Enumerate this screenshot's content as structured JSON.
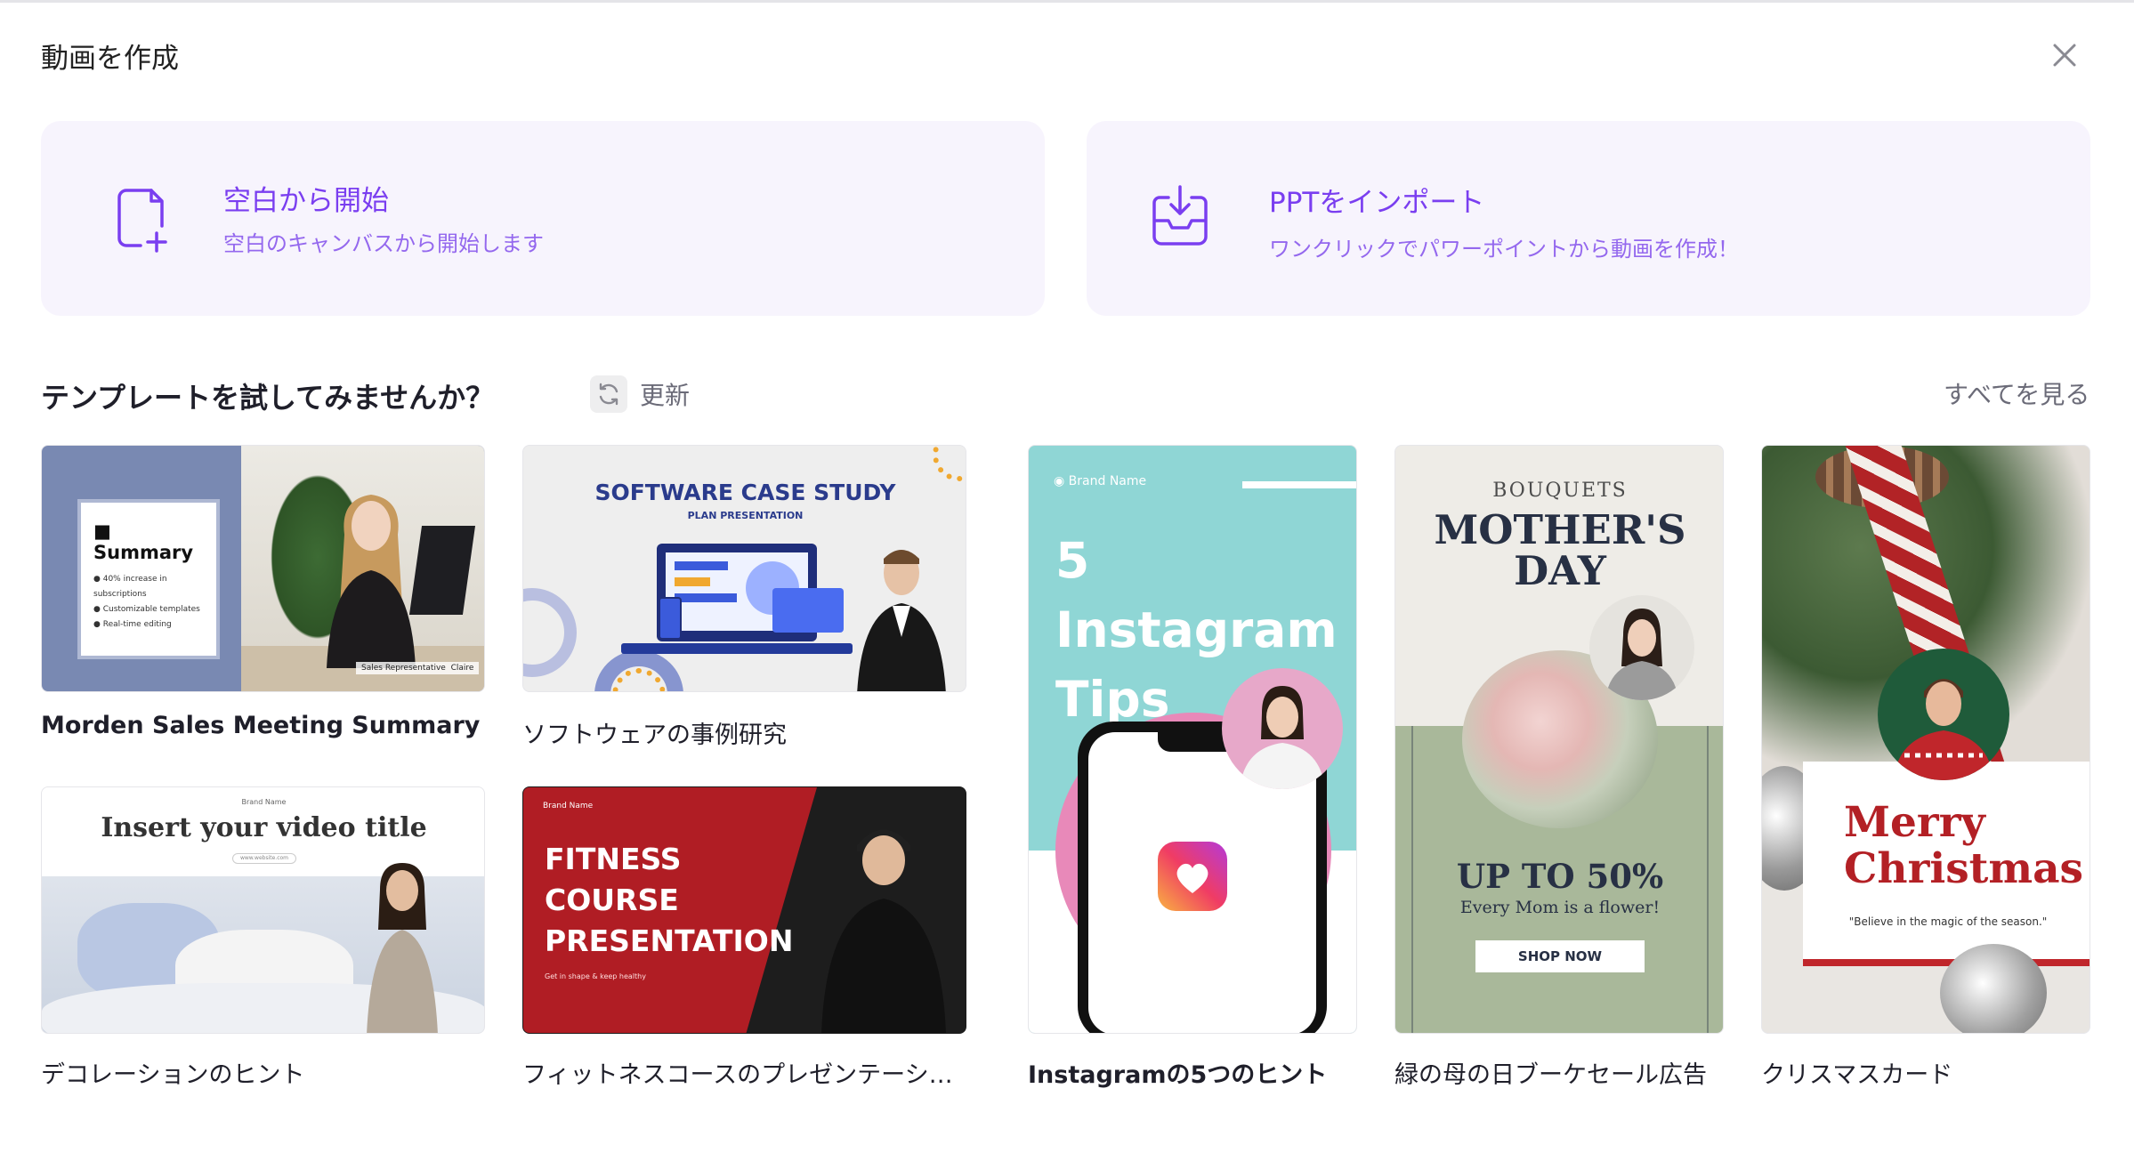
{
  "dialog": {
    "title": "動画を作成",
    "close_icon": "close-icon"
  },
  "actions": [
    {
      "icon": "file-plus-icon",
      "title": "空白から開始",
      "description": "空白のキャンバスから開始します"
    },
    {
      "icon": "inbox-download-icon",
      "title": "PPTをインポート",
      "description": "ワンクリックでパワーポイントから動画を作成！"
    }
  ],
  "templates_section": {
    "title": "テンプレートを試してみませんか？",
    "refresh_label": "更新",
    "see_all_label": "すべてを見る"
  },
  "templates": [
    {
      "caption": "Morden Sales Meeting Summary",
      "thumb": {
        "heading": "Summary",
        "bullets": [
          "40% increase in subscriptions",
          "Customizable templates",
          "Real-time editing"
        ],
        "tag_role": "Sales Representative",
        "tag_name": "Claire"
      }
    },
    {
      "caption": "ソフトウェアの事例研究",
      "thumb": {
        "heading": "SOFTWARE CASE STUDY",
        "sub": "PLAN PRESENTATION"
      }
    },
    {
      "caption": "デコレーションのヒント",
      "thumb": {
        "brand": "Brand Name",
        "heading": "Insert your video title",
        "url": "www.website.com"
      }
    },
    {
      "caption": "フィットネスコースのプレゼンテーシ…",
      "thumb": {
        "brand": "Brand Name",
        "heading": "FITNESS\nCOURSE\nPRESENTATION",
        "sub": "Get in shape & keep healthy"
      }
    },
    {
      "caption": "Instagramの5つのヒント",
      "thumb": {
        "brand": "Brand Name",
        "heading": "5 Instagram\nTips"
      }
    },
    {
      "caption": "緑の母の日ブーケセール広告",
      "thumb": {
        "top": "BOUQUETS",
        "heading": "MOTHER'S\nDAY",
        "offer": "UP TO 50%",
        "tagline": "Every Mom is a flower!",
        "button": "SHOP NOW"
      }
    },
    {
      "caption": "クリスマスカード",
      "thumb": {
        "heading": "Merry\nChristmas",
        "quote": "\"Believe in the magic of the season.\""
      }
    }
  ],
  "colors": {
    "accent": "#7a3ef0",
    "accent_light": "#9468ee",
    "card_bg": "#f7f4fd",
    "muted_text": "#6b6b78"
  }
}
